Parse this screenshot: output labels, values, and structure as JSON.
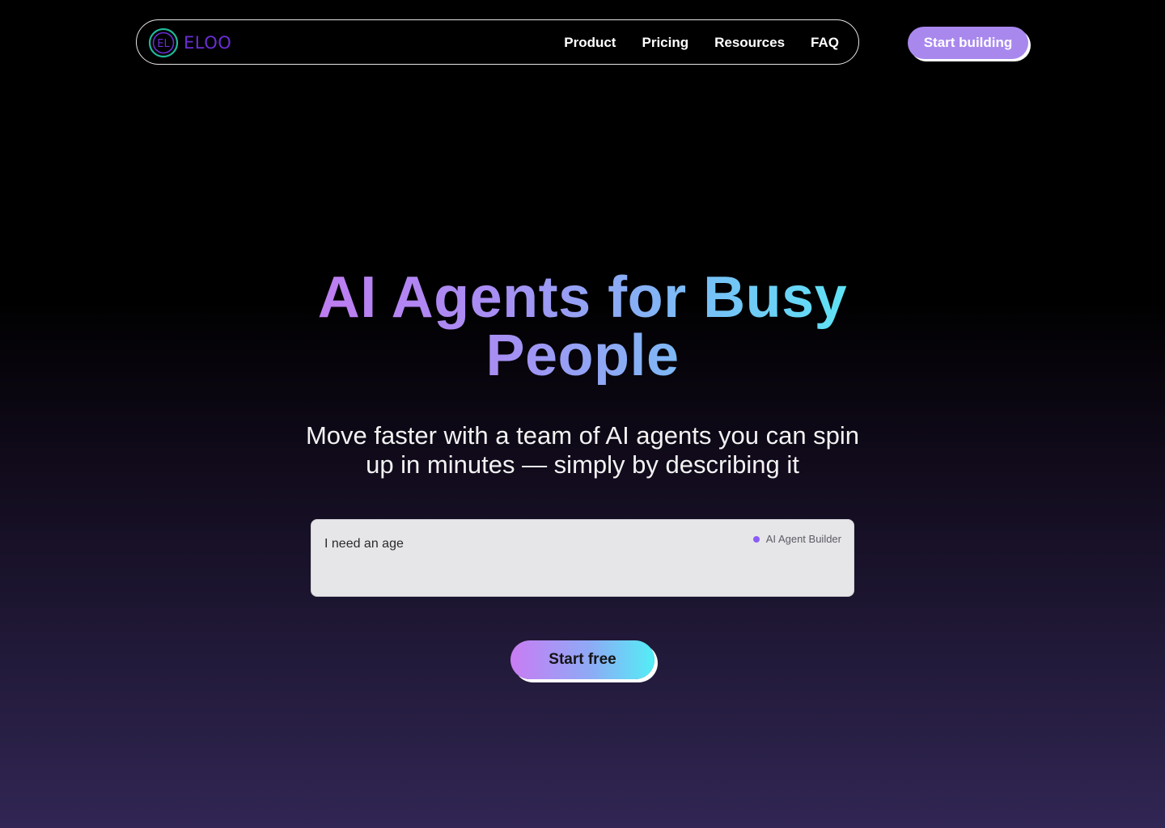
{
  "brand": {
    "logo_mark": "EL",
    "name": "ELOO",
    "logo_icon": "circle-el-monogram-icon",
    "colors": {
      "logo_outer": "#1fb89a",
      "logo_inner": "#6a2ed6"
    }
  },
  "nav": {
    "links": [
      {
        "label": "Product"
      },
      {
        "label": "Pricing"
      },
      {
        "label": "Resources"
      },
      {
        "label": "FAQ"
      }
    ],
    "cta_label": "Start building"
  },
  "hero": {
    "title": "AI Agents for Busy People",
    "subtitle": "Move faster with a team of AI agents you can spin up in minutes — simply by describing it"
  },
  "prompt": {
    "value": "I need an age",
    "tag": "AI Agent Builder"
  },
  "main_cta": {
    "label": "Start free"
  },
  "colors": {
    "accent_purple": "#a988ee",
    "gradient_start": "#c07bf0",
    "gradient_end": "#5ce7f5",
    "background_bottom": "#312654"
  }
}
